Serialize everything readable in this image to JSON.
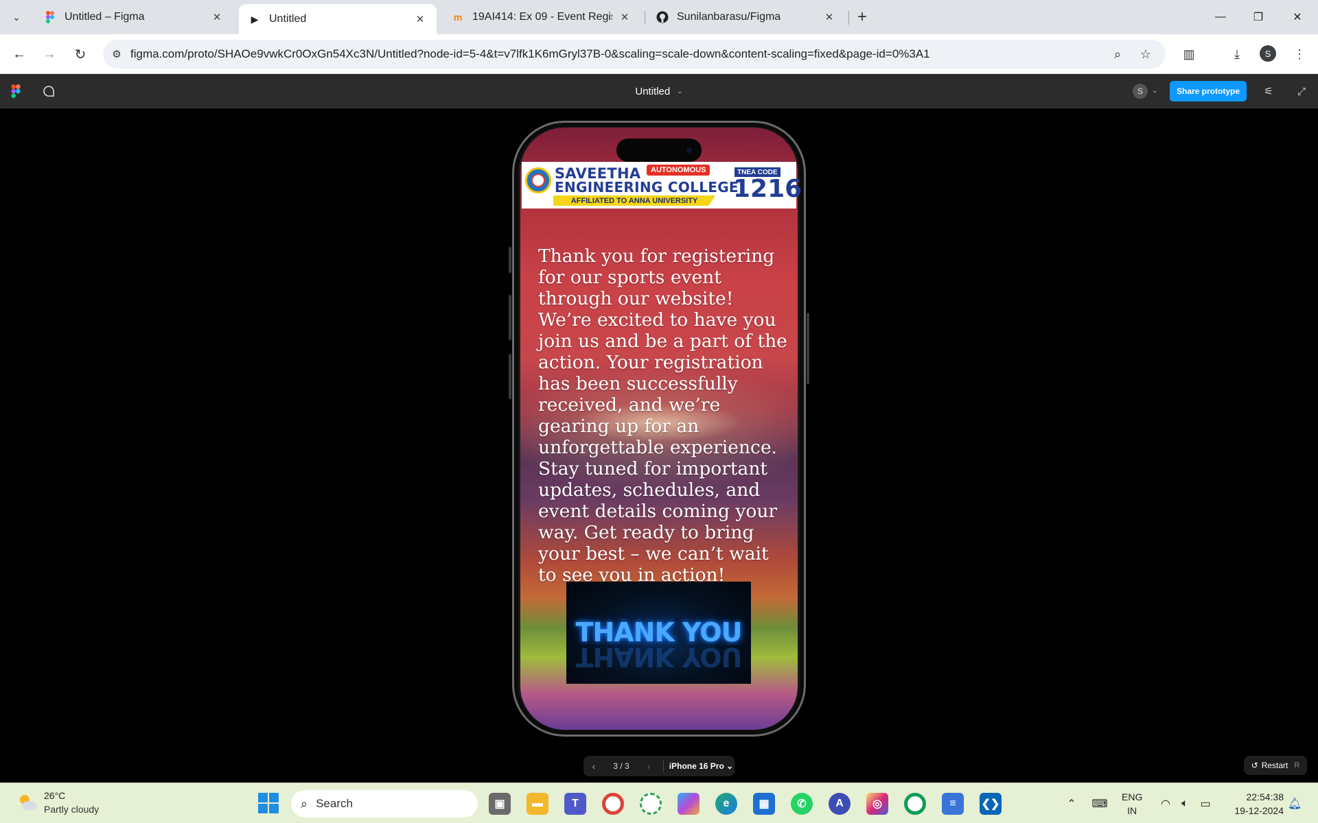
{
  "browser": {
    "tabs": [
      {
        "title": "Untitled – Figma",
        "icon": "figma-icon",
        "active": false
      },
      {
        "title": "Untitled",
        "icon": "play-icon",
        "active": true
      },
      {
        "title": "19AI414: Ex 09 - Event Registrat",
        "icon": "moodle-icon",
        "active": false
      },
      {
        "title": "Sunilanbarasu/Figma",
        "icon": "github-icon",
        "active": false
      }
    ],
    "url": "figma.com/proto/SHAOe9vwkCr0OxGn54Xc3N/Untitled?node-id=5-4&t=v7lfk1K6mGryl37B-0&scaling=scale-down&content-scaling=fixed&page-id=0%3A1",
    "profile_initial": "S"
  },
  "figma": {
    "file_title": "Untitled",
    "avatar_initial": "S",
    "share_label": "Share prototype"
  },
  "prototype": {
    "college": {
      "name_line1": "SAVEETHA",
      "name_line2": "ENGINEERING COLLEGE",
      "badge": "AUTONOMOUS",
      "affiliation": "AFFILIATED TO ANNA UNIVERSITY",
      "tnea_label": "TNEA CODE",
      "tnea_code": "1216"
    },
    "message": "Thank you for registering for our sports event through our website! We’re excited to have you join us and be a part of the action. Your registration has been successfully received, and we’re gearing up for an unforgettable experience. Stay tuned for important updates, schedules, and event details coming your way. Get ready to bring your best – we can’t wait to see you in action!",
    "thank_you_image_text": "THANK YOU"
  },
  "controls": {
    "page_counter": "3 / 3",
    "device": "iPhone 16 Pro",
    "restart_label": "Restart",
    "restart_key": "R"
  },
  "taskbar": {
    "temperature": "26°C",
    "weather": "Partly cloudy",
    "search_label": "Search",
    "lang_line1": "ENG",
    "lang_line2": "IN",
    "time": "22:54:38",
    "date": "19-12-2024"
  },
  "colors": {
    "figma_blue": "#0d99ff",
    "college_blue": "#223d94",
    "college_red": "#e53026",
    "college_yellow": "#f4d617"
  }
}
